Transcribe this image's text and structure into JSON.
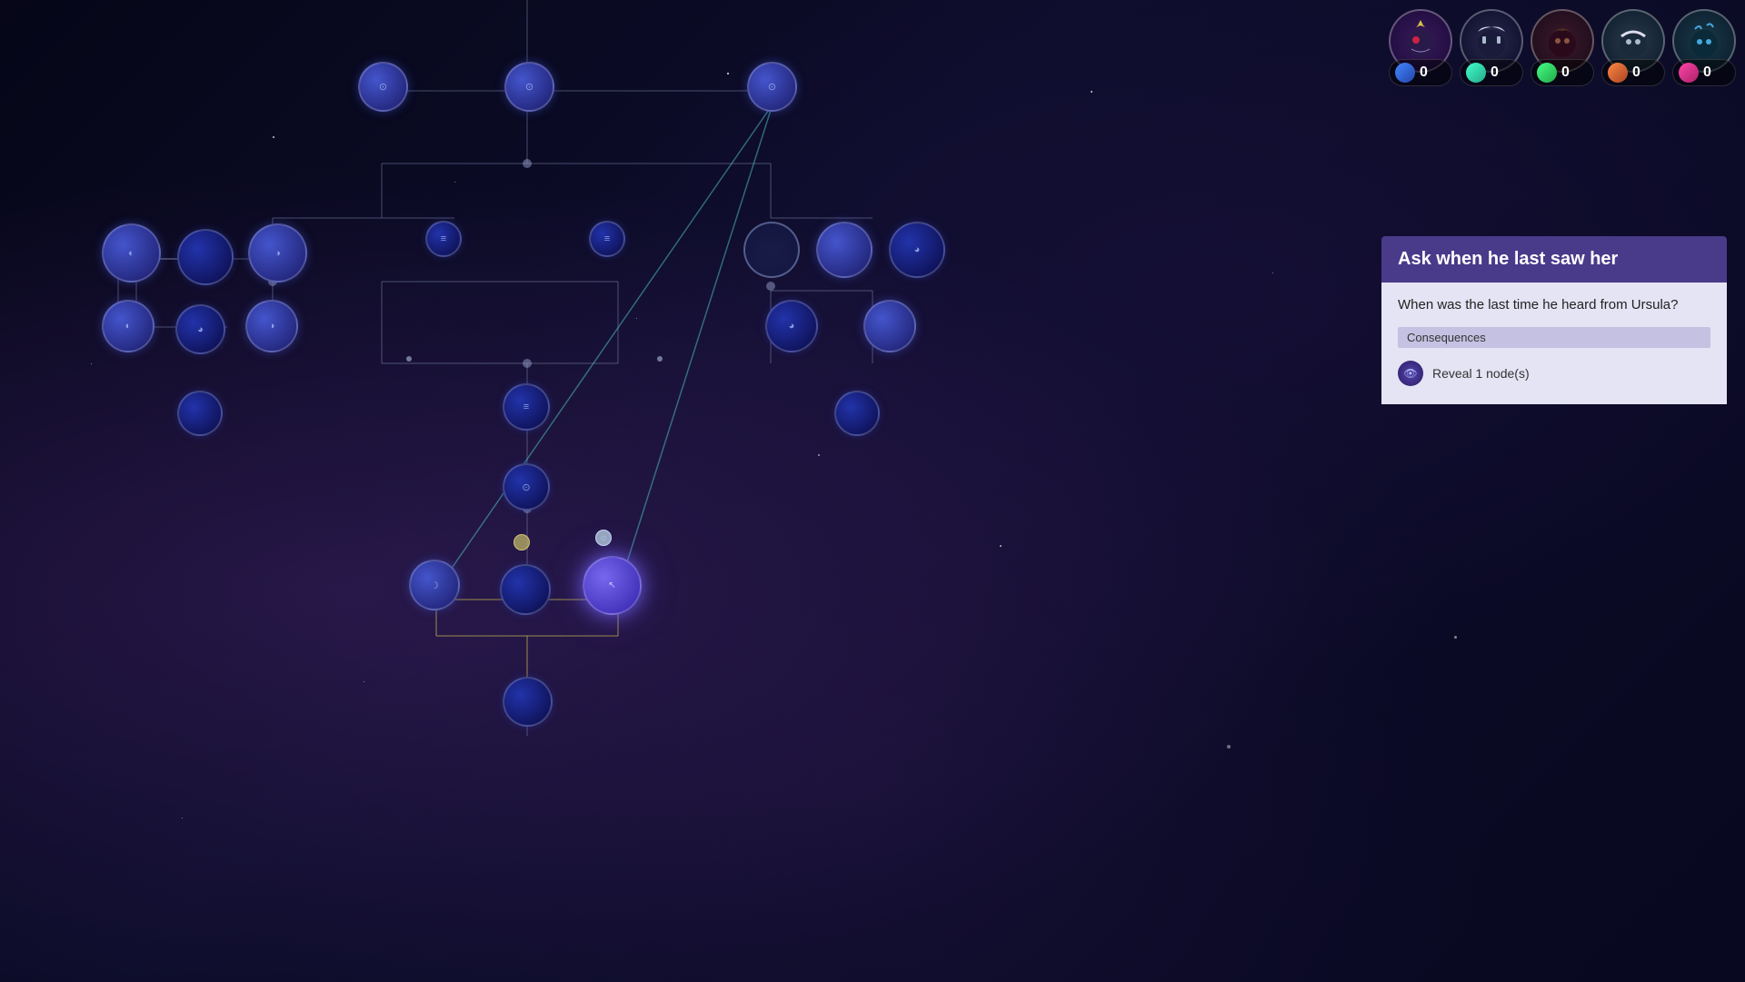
{
  "background": {
    "color": "#0a0a1a"
  },
  "resources": [
    {
      "id": "char1",
      "avatar_type": "crown",
      "color_class": "avatar-1",
      "icon_class": "res-blue",
      "count": "0",
      "symbol": "👁"
    },
    {
      "id": "char2",
      "avatar_type": "normal",
      "color_class": "avatar-2",
      "icon_class": "res-teal",
      "count": "0",
      "symbol": "👤"
    },
    {
      "id": "char3",
      "avatar_type": "normal",
      "color_class": "avatar-3",
      "icon_class": "res-green",
      "count": "0",
      "symbol": "👤"
    },
    {
      "id": "char4",
      "avatar_type": "normal",
      "color_class": "avatar-4",
      "icon_class": "res-orange",
      "count": "0",
      "symbol": "👤"
    },
    {
      "id": "char5",
      "avatar_type": "normal",
      "color_class": "avatar-5",
      "icon_class": "res-pink",
      "count": "0",
      "symbol": "👤"
    }
  ],
  "tooltip": {
    "title": "Ask when he last saw her",
    "question": "When was the last time he heard from Ursula?",
    "consequences_label": "Consequences",
    "consequence": {
      "icon": "👁",
      "text": "Reveal 1 node(s)"
    }
  },
  "graph": {
    "description": "Dialogue tree node graph"
  }
}
